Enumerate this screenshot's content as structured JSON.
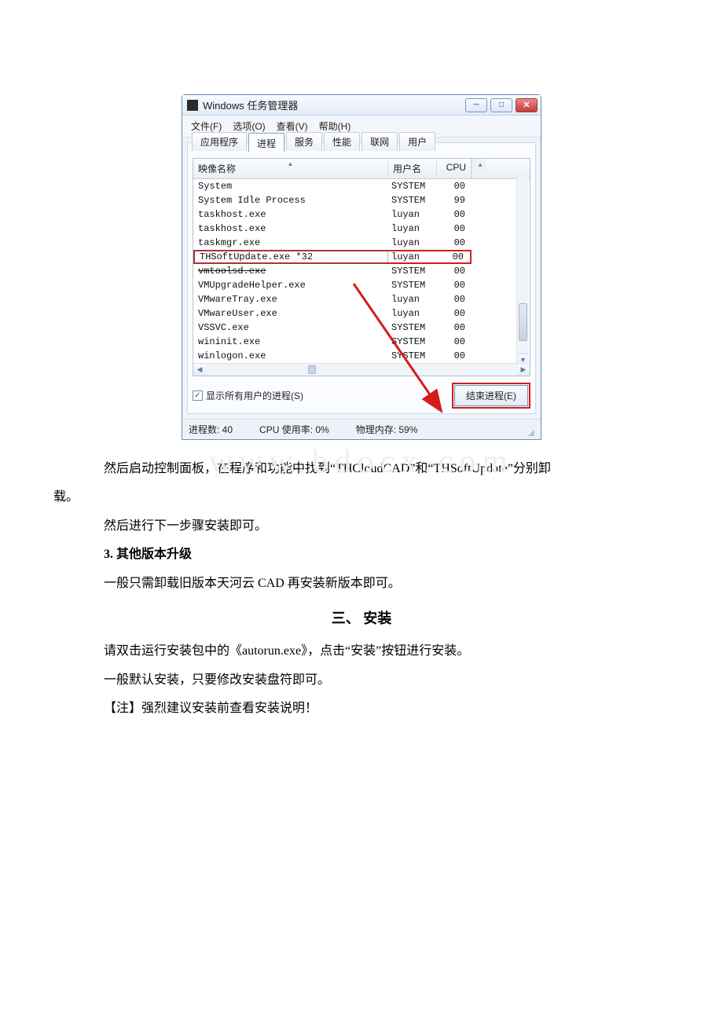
{
  "taskmgr": {
    "title": "Windows 任务管理器",
    "menu": {
      "file": "文件(F)",
      "options": "选项(O)",
      "view": "查看(V)",
      "help": "帮助(H)"
    },
    "tabs": {
      "apps": "应用程序",
      "processes": "进程",
      "services": "服务",
      "performance": "性能",
      "networking": "联网",
      "users": "用户"
    },
    "columns": {
      "image_name": "映像名称",
      "user": "用户名",
      "cpu": "CPU"
    },
    "processes": [
      {
        "name": "System",
        "user": "SYSTEM",
        "cpu": "00"
      },
      {
        "name": "System Idle Process",
        "user": "SYSTEM",
        "cpu": "99"
      },
      {
        "name": "taskhost.exe",
        "user": "luyan",
        "cpu": "00"
      },
      {
        "name": "taskhost.exe",
        "user": "luyan",
        "cpu": "00"
      },
      {
        "name": "taskmgr.exe",
        "user": "luyan",
        "cpu": "00"
      },
      {
        "name": "THSoftUpdate.exe *32",
        "user": "luyan",
        "cpu": "00"
      },
      {
        "name": "vmtoolsd.exe",
        "user": "SYSTEM",
        "cpu": "00"
      },
      {
        "name": "VMUpgradeHelper.exe",
        "user": "SYSTEM",
        "cpu": "00"
      },
      {
        "name": "VMwareTray.exe",
        "user": "luyan",
        "cpu": "00"
      },
      {
        "name": "VMwareUser.exe",
        "user": "luyan",
        "cpu": "00"
      },
      {
        "name": "VSSVC.exe",
        "user": "SYSTEM",
        "cpu": "00"
      },
      {
        "name": "wininit.exe",
        "user": "SYSTEM",
        "cpu": "00"
      },
      {
        "name": "winlogon.exe",
        "user": "SYSTEM",
        "cpu": "00"
      }
    ],
    "highlight_index": 5,
    "strike_index": 6,
    "show_all_label": "显示所有用户的进程(S)",
    "end_process_label": "结束进程(E)",
    "status": {
      "proc_count": "进程数: 40",
      "cpu_usage": "CPU 使用率: 0%",
      "mem": "物理内存: 59%"
    }
  },
  "watermark": "www.bdocx.com",
  "text": {
    "p1a": "然后启动控制面板，在程序和功能中找到“THCloudCAD”和“THSoftUpdate”分别卸",
    "p1b": "载。",
    "p2": "然后进行下一步骤安装即可。",
    "h3": "3. 其他版本升级",
    "p3": "一般只需卸载旧版本天河云 CAD 再安装新版本即可。",
    "section": "三、 安装",
    "p4": "请双击运行安装包中的《autorun.exe》，点击“安装”按钮进行安装。",
    "p5": "一般默认安装，只要修改安装盘符即可。",
    "p6": "【注】强烈建议安装前查看安装说明！"
  }
}
